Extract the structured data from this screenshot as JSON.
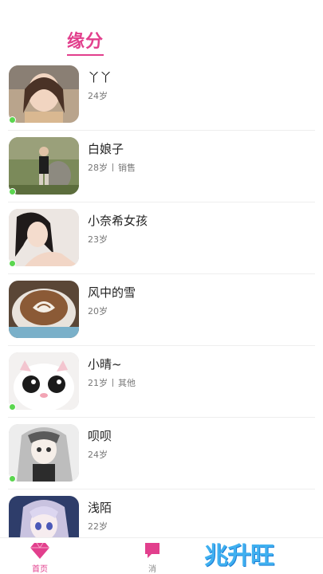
{
  "header": {
    "title": "缘分"
  },
  "users": [
    {
      "name": "丫丫",
      "age": "24岁",
      "job": ""
    },
    {
      "name": "白娘子",
      "age": "28岁",
      "job": "销售"
    },
    {
      "name": "小奈希女孩",
      "age": "23岁",
      "job": ""
    },
    {
      "name": "风中的雪",
      "age": "20岁",
      "job": ""
    },
    {
      "name": "小晴~",
      "age": "21岁",
      "job": "其他"
    },
    {
      "name": "呗呗",
      "age": "24岁",
      "job": ""
    },
    {
      "name": "浅陌",
      "age": "22岁",
      "job": ""
    }
  ],
  "tabbar": {
    "home_label": "首页",
    "message_label": "消"
  },
  "watermark": {
    "text": "兆升旺"
  },
  "colors": {
    "accent": "#e23f8d",
    "online": "#5bd64f"
  }
}
